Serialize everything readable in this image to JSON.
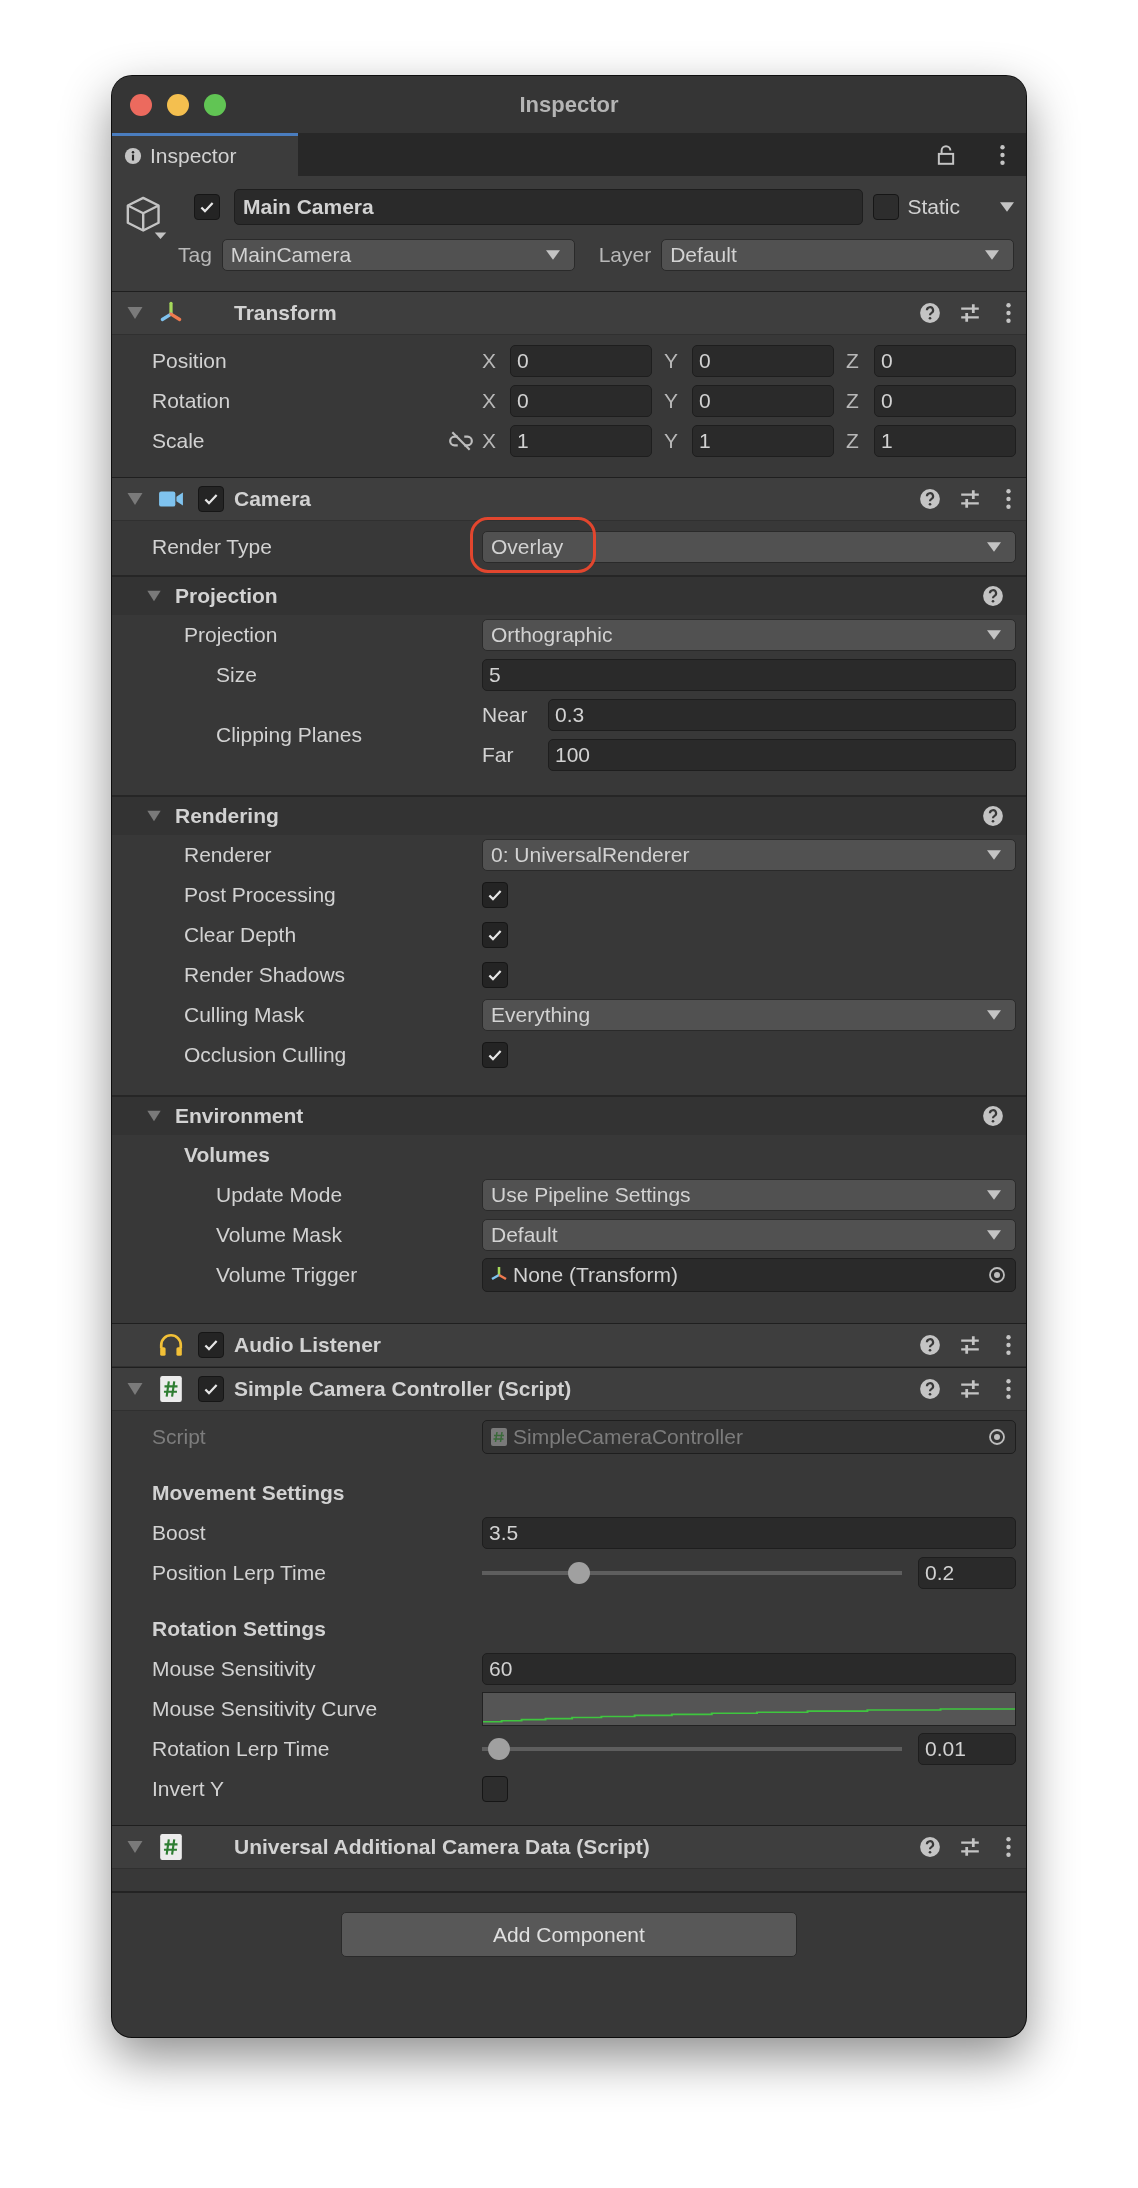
{
  "window": {
    "title": "Inspector"
  },
  "tab": {
    "label": "Inspector",
    "selected": true
  },
  "object": {
    "active": true,
    "name": "Main Camera",
    "static": false,
    "static_label": "Static",
    "tag_label": "Tag",
    "tag": "MainCamera",
    "layer_label": "Layer",
    "layer": "Default"
  },
  "components": [
    {
      "kind": "transform",
      "title": "Transform",
      "expanded": true,
      "rows": [
        {
          "kind": "vector",
          "label": "Position",
          "fields": [
            {
              "axis": "X",
              "value": "0"
            },
            {
              "axis": "Y",
              "value": "0"
            },
            {
              "axis": "Z",
              "value": "0"
            }
          ]
        },
        {
          "kind": "vector",
          "label": "Rotation",
          "fields": [
            {
              "axis": "X",
              "value": "0"
            },
            {
              "axis": "Y",
              "value": "0"
            },
            {
              "axis": "Z",
              "value": "0"
            }
          ]
        },
        {
          "kind": "vector",
          "label": "Scale",
          "constrain_proportions": false,
          "fields": [
            {
              "axis": "X",
              "value": "1"
            },
            {
              "axis": "Y",
              "value": "1"
            },
            {
              "axis": "Z",
              "value": "1"
            }
          ]
        }
      ]
    },
    {
      "kind": "camera",
      "title": "Camera",
      "expanded": true,
      "enabled": true,
      "rows": [
        {
          "kind": "dropdown",
          "label": "Render Type",
          "value": "Overlay",
          "highlighted": true
        },
        {
          "kind": "foldout",
          "label": "Projection",
          "expanded": true,
          "children": [
            {
              "kind": "dropdown",
              "label": "Projection",
              "value": "Orthographic",
              "children": [
                {
                  "kind": "text",
                  "label": "Size",
                  "value": "5"
                },
                {
                  "kind": "pair",
                  "label": "Clipping Planes",
                  "fields": [
                    {
                      "label": "Near",
                      "value": "0.3"
                    },
                    {
                      "label": "Far",
                      "value": "100"
                    }
                  ]
                }
              ]
            }
          ]
        },
        {
          "kind": "foldout",
          "label": "Rendering",
          "expanded": true,
          "children": [
            {
              "kind": "dropdown",
              "label": "Renderer",
              "value": "0: UniversalRenderer"
            },
            {
              "kind": "checkbox",
              "label": "Post Processing",
              "checked": true
            },
            {
              "kind": "checkbox",
              "label": "Clear Depth",
              "checked": true
            },
            {
              "kind": "checkbox",
              "label": "Render Shadows",
              "checked": true
            },
            {
              "kind": "dropdown",
              "label": "Culling Mask",
              "value": "Everything"
            },
            {
              "kind": "checkbox",
              "label": "Occlusion Culling",
              "checked": true
            }
          ]
        },
        {
          "kind": "foldout",
          "label": "Environment",
          "expanded": true,
          "children": [
            {
              "kind": "heading",
              "label": "Volumes",
              "children": [
                {
                  "kind": "dropdown",
                  "label": "Update Mode",
                  "value": "Use Pipeline Settings"
                },
                {
                  "kind": "dropdown",
                  "label": "Volume Mask",
                  "value": "Default"
                },
                {
                  "kind": "transformref",
                  "label": "Volume Trigger",
                  "value": "None (Transform)"
                }
              ]
            }
          ]
        }
      ]
    },
    {
      "kind": "audio",
      "title": "Audio Listener",
      "enabled": true
    },
    {
      "kind": "script",
      "title": "Simple Camera Controller (Script)",
      "expanded": true,
      "enabled": true,
      "rows": [
        {
          "kind": "scriptref",
          "label": "Script",
          "value": "SimpleCameraController",
          "disabled": true
        },
        {
          "kind": "heading",
          "label": "Movement Settings"
        },
        {
          "kind": "text",
          "label": "Boost",
          "value": "3.5"
        },
        {
          "kind": "slider",
          "label": "Position Lerp Time",
          "level": 0.21,
          "value": "0.2"
        },
        {
          "kind": "heading",
          "label": "Rotation Settings"
        },
        {
          "kind": "text",
          "label": "Mouse Sensitivity",
          "value": "60"
        },
        {
          "kind": "curve",
          "label": "Mouse Sensitivity Curve"
        },
        {
          "kind": "slider",
          "label": "Rotation Lerp Time",
          "level": 0.02,
          "value": "0.01"
        },
        {
          "kind": "checkbox",
          "label": "Invert Y",
          "checked": false
        }
      ]
    },
    {
      "kind": "script",
      "title": "Universal Additional Camera Data (Script)",
      "expanded": true
    }
  ],
  "add_component_button": "Add Component"
}
